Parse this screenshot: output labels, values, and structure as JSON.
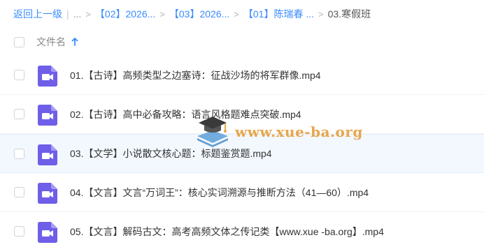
{
  "breadcrumb": {
    "back_label": "返回上一级",
    "separator": "|",
    "ellipsis": "...",
    "arrow": ">",
    "items": [
      {
        "label": "【02】2026..."
      },
      {
        "label": "【03】2026..."
      },
      {
        "label": "【01】陈瑞春 ..."
      }
    ],
    "current": "03.寒假班"
  },
  "header": {
    "column_label": "文件名",
    "sort_direction": "ascending"
  },
  "files": [
    {
      "name": "01.【古诗】高频类型之边塞诗：征战沙场的将军群像.mp4"
    },
    {
      "name": "02.【古诗】高中必备攻略：语言风格题难点突破.mp4"
    },
    {
      "name": "03.【文学】小说散文核心题：标题鉴赏题.mp4"
    },
    {
      "name": "04.【文言】文言“万词王”：核心实词溯源与推断方法（41—60）.mp4"
    },
    {
      "name": "05.【文言】解码古文：高考高频文体之传记类【www.xue -ba.org】.mp4"
    }
  ],
  "watermark": {
    "text": "www.xue-ba.org"
  },
  "colors": {
    "link_blue": "#3b8cff",
    "video_icon_purple": "#6e5ee8",
    "hover_row_bg": "#f3f8ff",
    "watermark_orange": "#e7a64c"
  }
}
